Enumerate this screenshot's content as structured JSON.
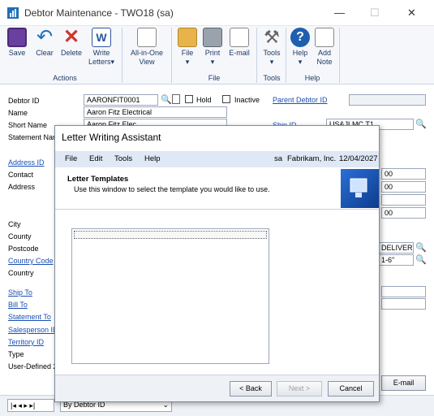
{
  "window": {
    "title": "Debtor Maintenance  -  TWO18 (sa)"
  },
  "ribbon": {
    "buttons": {
      "save": "Save",
      "clear": "Clear",
      "delete": "Delete",
      "write": "Write",
      "letters": "Letters",
      "allinone1": "All-in-One",
      "allinone2": "View",
      "file": "File",
      "print": "Print",
      "email": "E-mail",
      "tools": "Tools",
      "help": "Help",
      "add": "Add",
      "note": "Note"
    },
    "groups": {
      "actions": "Actions",
      "file": "File",
      "tools": "Tools",
      "help": "Help"
    }
  },
  "form": {
    "labels": {
      "debtor_id": "Debtor ID",
      "name": "Name",
      "short_name": "Short Name",
      "statement_name": "Statement Nam",
      "address_id": "Address ID",
      "contact": "Contact",
      "address": "Address",
      "city": "City",
      "county": "County",
      "postcode": "Postcode",
      "country_code": "Country Code",
      "country": "Country",
      "ship_to": "Ship To",
      "bill_to": "Bill To",
      "statement_to": "Statement To",
      "salesperson_id": "Salesperson ID",
      "territory_id": "Territory ID",
      "type": "Type",
      "user_defined": "User-Defined 2",
      "hold": "Hold",
      "inactive": "Inactive",
      "parent_debtor_id": "Parent Debtor ID",
      "ship_id": "Ship ID"
    },
    "values": {
      "debtor_id": "AARONFIT0001",
      "name": "Aaron Fitz Electrical",
      "short_name": "Aaron Fitz Elec",
      "ship_id_value": "US&JLMC T1",
      "right1": "00",
      "right2": "00",
      "right3": "00",
      "delivery": "DELIVERY",
      "plus6": "1-6\""
    },
    "email_button": "E-mail",
    "sort_by": "By Debtor ID"
  },
  "dialog": {
    "title": "Letter Writing Assistant",
    "menu": [
      "File",
      "Edit",
      "Tools",
      "Help"
    ],
    "status_user": "sa",
    "status_company": "Fabrikam, Inc.",
    "status_date": "12/04/2027",
    "heading": "Letter Templates",
    "subtext": "Use this window to select the template you would like to use.",
    "back": "< Back",
    "next": "Next >",
    "cancel": "Cancel"
  }
}
